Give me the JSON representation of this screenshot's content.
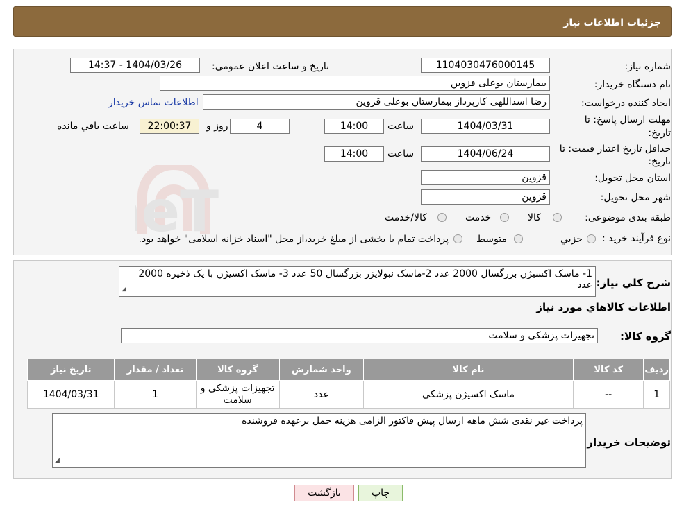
{
  "header": {
    "title": "جزئیات اطلاعات نیاز"
  },
  "details": {
    "need_number_label": "شماره نیاز:",
    "need_number": "1104030476000145",
    "announce_label": "تاریخ و ساعت اعلان عمومی:",
    "announce_value": "1404/03/26 - 14:37",
    "buyer_label": "نام دستگاه خریدار:",
    "buyer_value": "بیمارستان بوعلی قزوین",
    "creator_label": "ایجاد کننده درخواست:",
    "creator_value": "رضا اسداللهی کارپرداز بیمارستان بوعلی قزوین",
    "contact_link": "اطلاعات تماس خریدار",
    "deadline_label_1": "مهلت ارسال پاسخ: تا",
    "deadline_label_2": "تاریخ:",
    "deadline_date": "1404/03/31",
    "time_label": "ساعت",
    "deadline_time": "14:00",
    "days_value": "4",
    "days_label": "روز و",
    "remaining_time": "22:00:37",
    "remaining_label": "ساعت باقي مانده",
    "validity_label_1": "حداقل تاریخ اعتبار قیمت: تا",
    "validity_label_2": "تاریخ:",
    "validity_date": "1404/06/24",
    "validity_time": "14:00",
    "province_label": "استان محل تحویل:",
    "province_value": "قزوین",
    "city_label": "شهر محل تحویل:",
    "city_value": "قزوین",
    "category_label": "طبقه بندی موضوعی:",
    "category_options": [
      "کالا",
      "خدمت",
      "کالا/خدمت"
    ],
    "process_label": "نوع فرآیند خرید :",
    "process_options": [
      "جزیي",
      "متوسط"
    ],
    "process_note": "پرداخت تمام یا بخشی از مبلغ خرید،از محل \"اسناد خزانه اسلامی\" خواهد بود."
  },
  "summary": {
    "label": "شرح کلي نیاز:",
    "text": "1- ماسک اکسیژن بزرگسال  2000 عدد 2-ماسک نبولایزر بزرگسال 50 عدد 3- ماسک اکسیژن با یک ذخیره 2000 عدد",
    "goods_heading": "اطلاعات کالاهاي مورد نیاز",
    "group_label": "گروه کالا:",
    "group_value": "تجهیزات پزشکی و سلامت"
  },
  "table": {
    "headers": [
      "ردیف",
      "کد کالا",
      "نام کالا",
      "واحد شمارش",
      "گروه کالا",
      "تعداد / مقدار",
      "تاریخ نیاز"
    ],
    "rows": [
      [
        "1",
        "--",
        "ماسک اکسیژن پزشکی",
        "عدد",
        "تجهیزات پزشکی و سلامت",
        "1",
        "1404/03/31"
      ]
    ]
  },
  "notes": {
    "label": "توضیحات خریدار:",
    "text": "پرداخت غیر نقدی شش ماهه ارسال پیش فاکتور الزامی هزینه حمل برعهده فروشنده"
  },
  "buttons": {
    "print": "چاپ",
    "back": "بازگشت"
  },
  "watermark": {
    "text": "AriaTender.neT"
  },
  "colors": {
    "header_bg": "#8c6a3d",
    "table_header_bg": "#9a9a9a",
    "print_bg": "#e8f5dc",
    "back_bg": "#fbe3e5",
    "link": "#1b3ba6"
  }
}
